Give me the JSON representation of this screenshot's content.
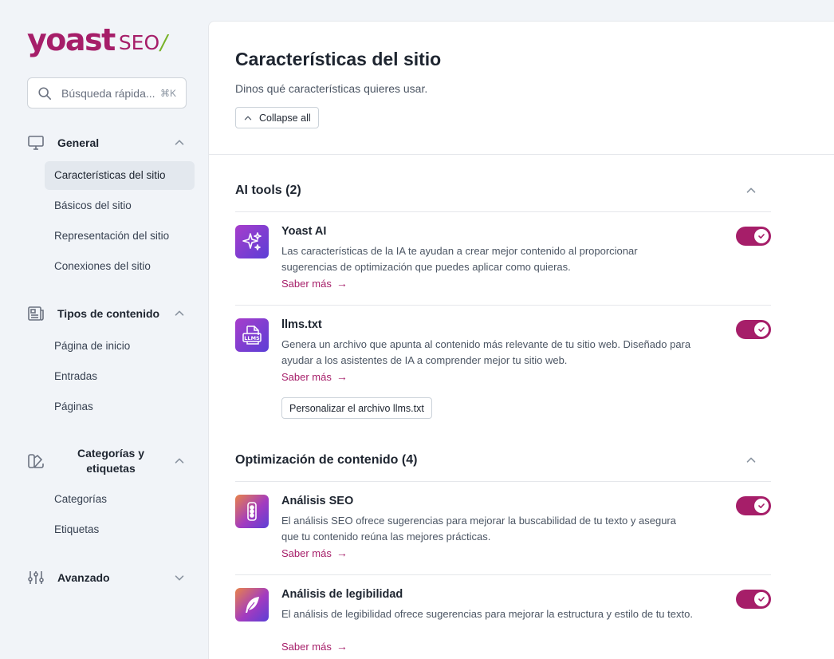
{
  "brand": {
    "logo_text": "yoast",
    "logo_suffix": "SEO",
    "logo_slash": "/",
    "accent": "#a61e69",
    "slash_color": "#77b227"
  },
  "search": {
    "placeholder": "Búsqueda rápida...",
    "shortcut": "⌘K"
  },
  "sidebar": {
    "groups": [
      {
        "label": "General",
        "icon": "desktop-icon",
        "expanded": true,
        "items": [
          {
            "label": "Características del sitio",
            "active": true
          },
          {
            "label": "Básicos del sitio"
          },
          {
            "label": "Representación del sitio"
          },
          {
            "label": "Conexiones del sitio"
          }
        ]
      },
      {
        "label": "Tipos de contenido",
        "icon": "newspaper-icon",
        "expanded": true,
        "items": [
          {
            "label": "Página de inicio"
          },
          {
            "label": "Entradas"
          },
          {
            "label": "Páginas"
          }
        ]
      },
      {
        "label": "Categorías y etiquetas",
        "label_line1": "Categorías y",
        "label_line2": "etiquetas",
        "icon": "color-swatch-icon",
        "expanded": true,
        "items": [
          {
            "label": "Categorías"
          },
          {
            "label": "Etiquetas"
          }
        ]
      },
      {
        "label": "Avanzado",
        "icon": "adjustments-icon",
        "expanded": false,
        "items": []
      }
    ]
  },
  "main": {
    "title": "Características del sitio",
    "description": "Dinos qué características quieres usar.",
    "collapse_all": "Collapse all",
    "sections": [
      {
        "title": "AI tools (2)",
        "features": [
          {
            "title": "Yoast AI",
            "icon": "sparkles-icon",
            "description": "Las características de la IA te ayudan a crear mejor contenido al proporcionar sugerencias de optimización que puedes aplicar como quieras.",
            "link": "Saber más",
            "enabled": true
          },
          {
            "title": "llms.txt",
            "icon": "llms-file-icon",
            "icon_text": "LLMS",
            "description": "Genera un archivo que apunta al contenido más relevante de tu sitio web. Diseñado para ayudar a los asistentes de IA a comprender mejor tu sitio web.",
            "link": "Saber más",
            "button": "Personalizar el archivo llms.txt",
            "enabled": true
          }
        ]
      },
      {
        "title": "Optimización de contenido (4)",
        "features": [
          {
            "title": "Análisis SEO",
            "icon": "traffic-light-icon",
            "description": "El análisis SEO ofrece sugerencias para mejorar la buscabilidad de tu texto y asegura que tu contenido reúna las mejores prácticas.",
            "link": "Saber más",
            "enabled": true
          },
          {
            "title": "Análisis de legibilidad",
            "icon": "feather-icon",
            "description": "El análisis de legibilidad ofrece sugerencias para mejorar la estructura y estilo de tu texto.",
            "link": "Saber más",
            "enabled": true
          }
        ]
      }
    ]
  }
}
